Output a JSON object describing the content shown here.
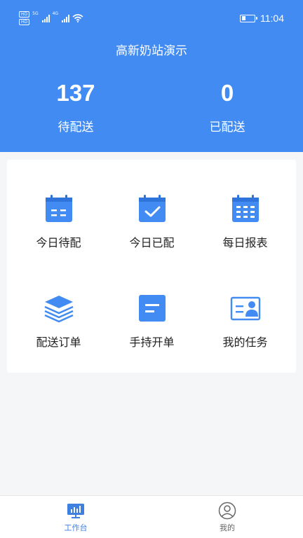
{
  "status_bar": {
    "badges": [
      "HD",
      "HD"
    ],
    "network_tags": [
      "5G",
      "4G"
    ],
    "time": "11:04"
  },
  "header": {
    "title": "高新奶站演示",
    "stats": [
      {
        "value": "137",
        "label": "待配送"
      },
      {
        "value": "0",
        "label": "已配送"
      }
    ]
  },
  "menu": {
    "items": [
      {
        "label": "今日待配",
        "icon": "calendar-icon"
      },
      {
        "label": "今日已配",
        "icon": "calendar-check-icon"
      },
      {
        "label": "每日报表",
        "icon": "calendar-grid-icon"
      },
      {
        "label": "配送订单",
        "icon": "layers-icon"
      },
      {
        "label": "手持开单",
        "icon": "document-icon"
      },
      {
        "label": "我的任务",
        "icon": "id-card-icon"
      }
    ]
  },
  "tabbar": {
    "tabs": [
      {
        "label": "工作台",
        "icon": "workbench-icon",
        "active": true
      },
      {
        "label": "我的",
        "icon": "user-icon",
        "active": false
      }
    ]
  },
  "colors": {
    "primary": "#428bf3",
    "active_tab": "#3f7fe0",
    "inactive_tab": "#666666"
  }
}
